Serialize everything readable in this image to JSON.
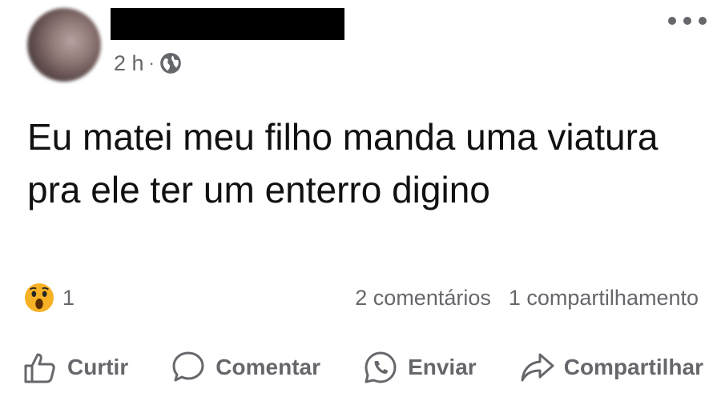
{
  "post": {
    "author_name": "",
    "time": "2 h",
    "separator": "·",
    "privacy_icon": "globe-icon",
    "text": "Eu matei meu filho manda uma viatura pra ele ter um enterro digino"
  },
  "reactions": {
    "icon": "wow-reaction-icon",
    "count": "1"
  },
  "stats": {
    "comments": "2 comentários",
    "shares": "1 compartilhamento"
  },
  "actions": {
    "like": "Curtir",
    "comment": "Comentar",
    "send": "Enviar",
    "share": "Compartilhar"
  },
  "colors": {
    "secondary_text": "#65676b",
    "wow_face": "#f7b125"
  }
}
